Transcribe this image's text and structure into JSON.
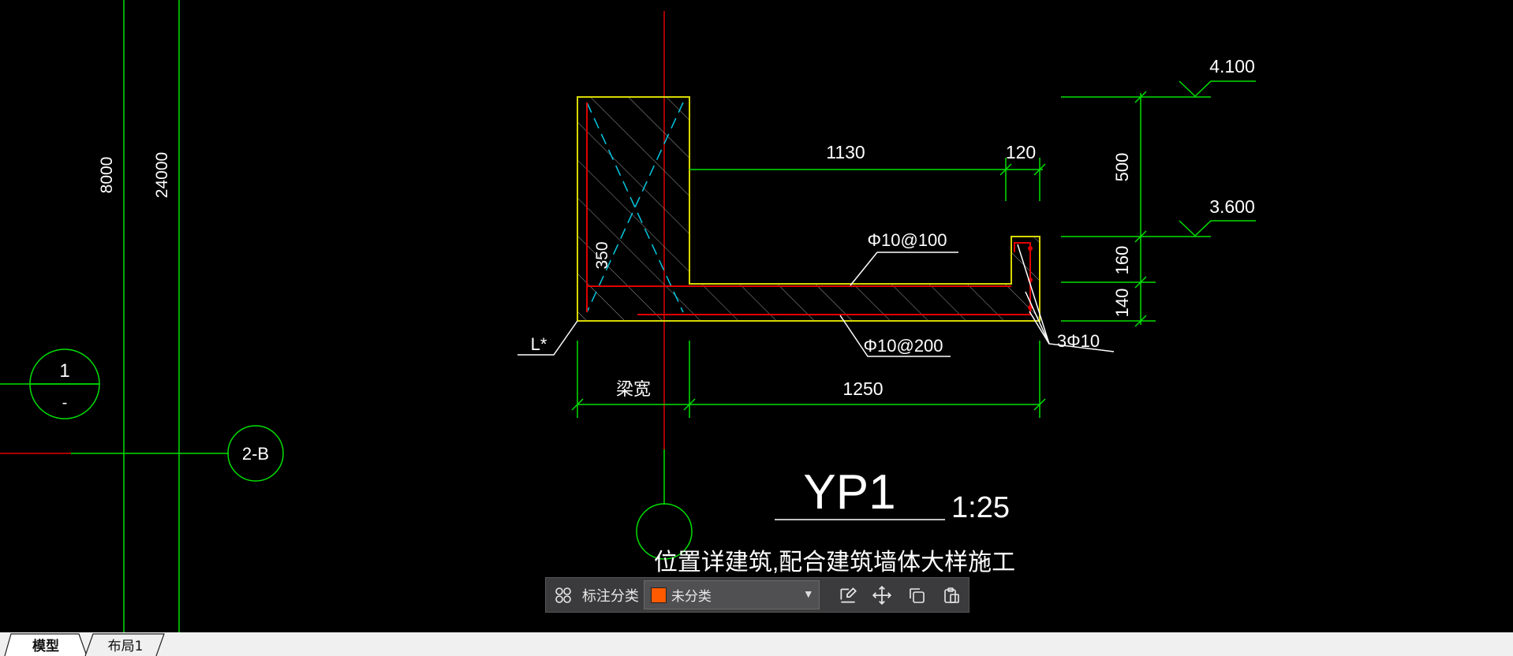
{
  "drawing": {
    "grid_dims": {
      "d1": "8000",
      "d2": "24000"
    },
    "axis_labels": {
      "axis1_top": "1",
      "axis1_bottom": "-",
      "axis2": "2-B"
    },
    "elevations": {
      "top": "4.100",
      "mid": "3.600"
    },
    "dims": {
      "d1130": "1130",
      "d120": "120",
      "d500": "500",
      "d160": "160",
      "d140": "140",
      "d350": "350",
      "beam_width": "梁宽",
      "d1250": "1250"
    },
    "rebar": {
      "top": "Φ10@100",
      "bottom": "Φ10@200",
      "long": "3Φ10"
    },
    "beam_tag": "L*",
    "detail": {
      "title": "YP1",
      "scale": "1:25",
      "note": "位置详建筑,配合建筑墙体大样施工"
    },
    "colors": {
      "green": "#00e000",
      "yellow": "#d8d800",
      "red": "#e00000",
      "cyan": "#00c8e0",
      "white": "#ffffff",
      "background": "#000000"
    }
  },
  "toolbar": {
    "grid_icon": "grid-icon",
    "label": "标注分类",
    "category": {
      "selected": "未分类",
      "swatch_color": "#ff5a00"
    },
    "icons": [
      "edit-icon",
      "move-icon",
      "copy-icon",
      "paste-icon"
    ]
  },
  "tabs": [
    {
      "label": "模型",
      "active": true
    },
    {
      "label": "布局1",
      "active": false
    }
  ]
}
